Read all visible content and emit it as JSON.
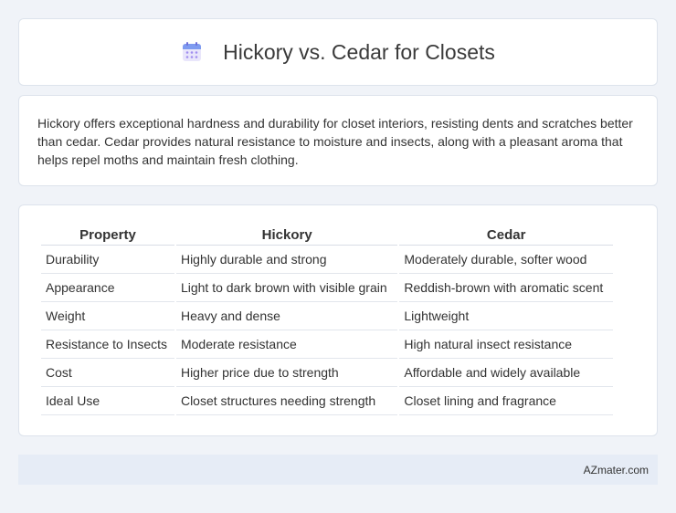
{
  "header": {
    "title": "Hickory vs. Cedar for Closets",
    "icon": "calendar-icon"
  },
  "summary": {
    "text": "Hickory offers exceptional hardness and durability for closet interiors, resisting dents and scratches better than cedar. Cedar provides natural resistance to moisture and insects, along with a pleasant aroma that helps repel moths and maintain fresh clothing."
  },
  "table": {
    "headers": [
      "Property",
      "Hickory",
      "Cedar"
    ],
    "rows": [
      [
        "Durability",
        "Highly durable and strong",
        "Moderately durable, softer wood"
      ],
      [
        "Appearance",
        "Light to dark brown with visible grain",
        "Reddish-brown with aromatic scent"
      ],
      [
        "Weight",
        "Heavy and dense",
        "Lightweight"
      ],
      [
        "Resistance to Insects",
        "Moderate resistance",
        "High natural insect resistance"
      ],
      [
        "Cost",
        "Higher price due to strength",
        "Affordable and widely available"
      ],
      [
        "Ideal Use",
        "Closet structures needing strength",
        "Closet lining and fragrance"
      ]
    ]
  },
  "footer": {
    "brand": "AZmater.com"
  },
  "colors": {
    "background": "#f0f3f8",
    "card": "#ffffff",
    "footer": "#e6ecf6",
    "icon_accent": "#8b7fe8"
  }
}
